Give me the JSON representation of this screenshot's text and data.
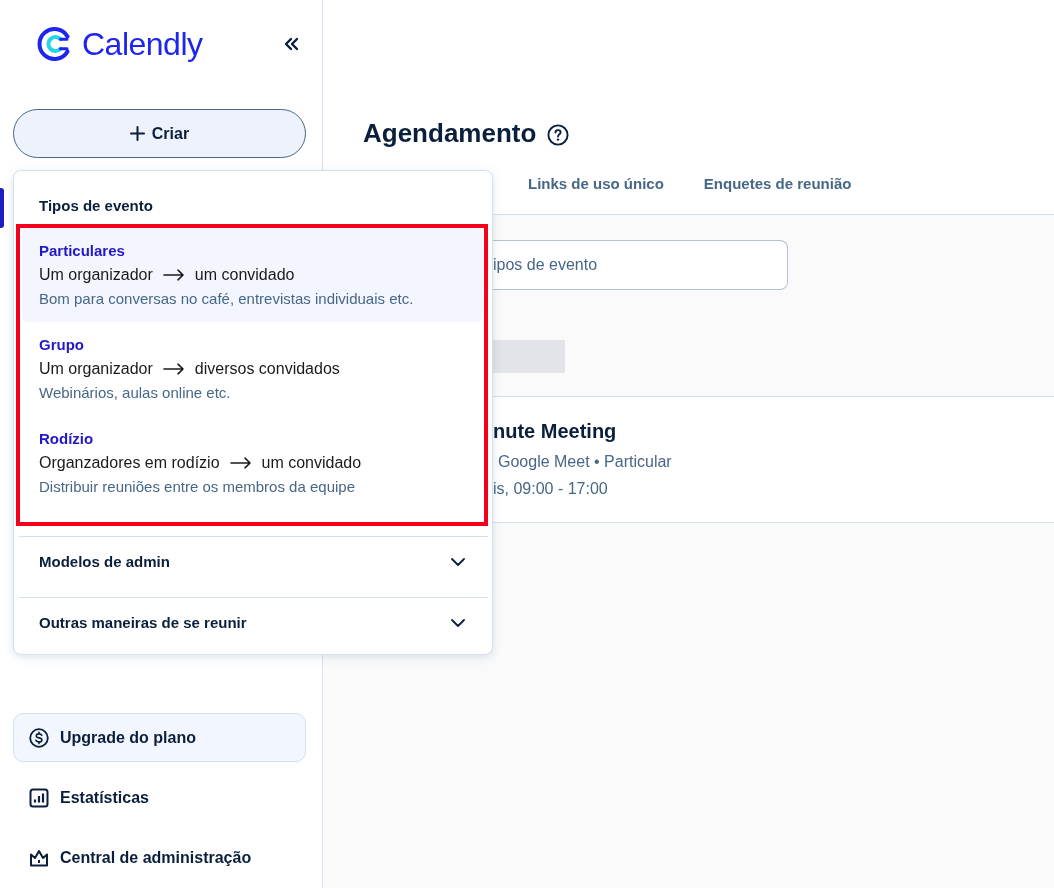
{
  "sidebar": {
    "logo": {
      "text": "Calendly"
    },
    "create_button": {
      "label": "Criar"
    },
    "nav_items": [
      {
        "selected": true
      }
    ],
    "bottom_items": [
      {
        "kind": "upgrade",
        "label": "Upgrade do plano"
      },
      {
        "kind": "link",
        "label": "Estatísticas"
      },
      {
        "kind": "link",
        "label": "Central de administração"
      }
    ]
  },
  "main": {
    "title": "Agendamento",
    "tabs": [
      {
        "label": "Links de uso único",
        "selected": false
      },
      {
        "label": "Enquetes de reunião",
        "selected": false
      }
    ],
    "search": {
      "placeholder": "ipos de evento"
    },
    "event_card": {
      "title": "nute Meeting",
      "details": "Google Meet • Particular",
      "schedule": "is, 09:00 - 17:00"
    }
  },
  "create_menu": {
    "heading": "Tipos de evento",
    "highlighted": true,
    "event_types": [
      {
        "name": "Particulares",
        "flow_from": "Um organizador",
        "flow_to": "um convidado",
        "description": "Bom para conversas no café, entrevistas individuais etc.",
        "selected": true
      },
      {
        "name": "Grupo",
        "flow_from": "Um organizador",
        "flow_to": "diversos convidados",
        "description": "Webinários, aulas online etc.",
        "selected": false
      },
      {
        "name": "Rodízio",
        "flow_from": "Organzadores em rodízio",
        "flow_to": "um convidado",
        "description": "Distribuir reuniões entre os membros da equipe",
        "selected": false
      }
    ],
    "sections": [
      {
        "label": "Modelos de admin",
        "expanded": false
      },
      {
        "label": "Outras maneiras de se reunir",
        "expanded": false
      }
    ]
  }
}
